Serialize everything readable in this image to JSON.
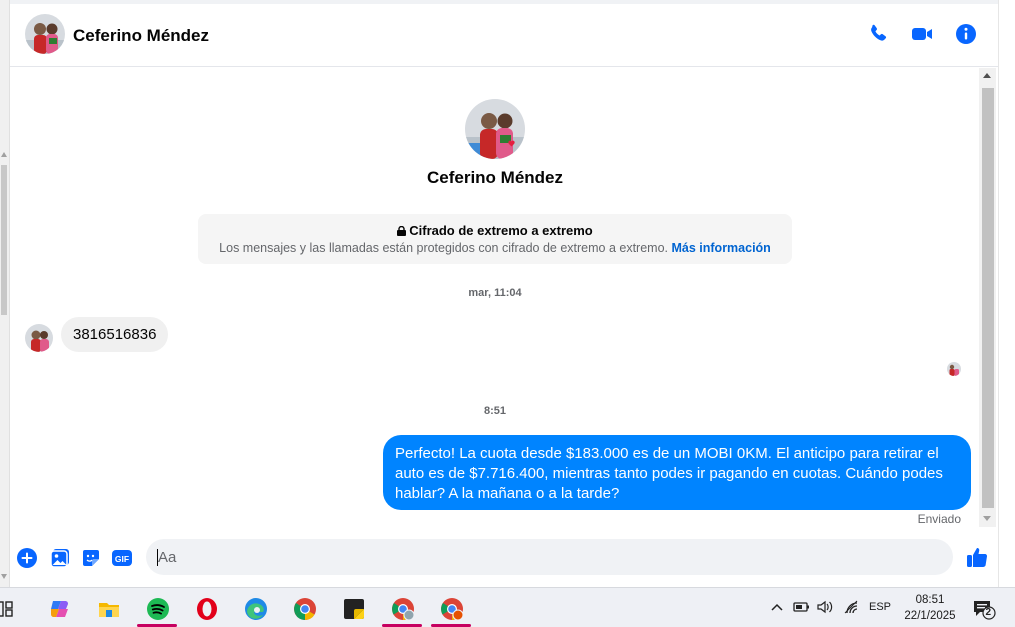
{
  "header": {
    "contact_name": "Ceferino Méndez"
  },
  "profile": {
    "name": "Ceferino Méndez"
  },
  "encryption": {
    "title": "Cifrado de extremo a extremo",
    "description": "Los mensajes y las llamadas están protegidos con cifrado de extremo a extremo.",
    "link": "Más información"
  },
  "messages": [
    {
      "timestamp": "mar, 11:04",
      "direction": "incoming",
      "text": "3816516836"
    },
    {
      "timestamp": "8:51",
      "direction": "outgoing",
      "text": "Perfecto! La cuota desde $183.000 es de un MOBI 0KM. El anticipo para retirar el auto es de $7.716.400, mientras tanto podes ir pagando en cuotas. Cuándo podes hablar? A la mañana o a la tarde?",
      "status": "Enviado"
    }
  ],
  "composer": {
    "placeholder": "Aa"
  },
  "taskbar": {
    "language": "ESP",
    "time": "08:51",
    "date": "22/1/2025",
    "notification_count": "2"
  },
  "colors": {
    "accent": "#0084ff",
    "icon_blue": "#0866ff",
    "bubble_in": "#f0f0f0"
  }
}
